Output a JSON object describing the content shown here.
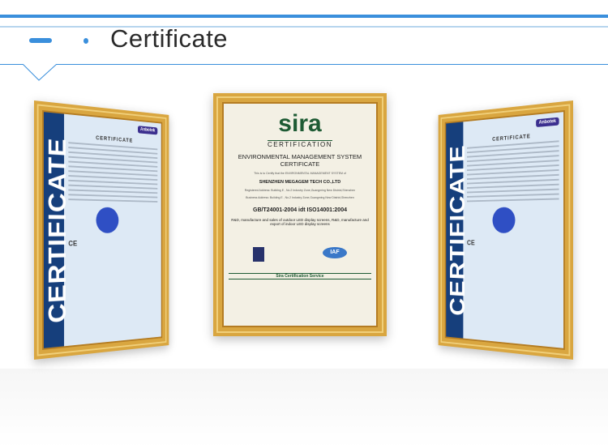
{
  "header": {
    "title": "Certificate"
  },
  "certificates": {
    "left": {
      "side_label": "CERTIFICATE",
      "heading": "CERTIFICATE",
      "badge": "Anbotek",
      "mark": "CE"
    },
    "center": {
      "brand": "sira",
      "brand_sub": "CERTIFICATION",
      "title_line1": "ENVIRONMENTAL MANAGEMENT SYSTEM",
      "title_line2": "CERTIFICATE",
      "intro": "This is to Certify that the ENVIRONMENTAL MANAGEMENT SYSTEM of",
      "company": "SHENZHEN MEGAGEM TECH CO.,LTD",
      "registered_address": "Registered Address: Building E , No.2 Industry Zone,Guangming New District,Shenzhen",
      "business_address": "Business Address: Building E , No.2 Industry Zone,Guangming New District,Shenzhen",
      "standard": "GB/T24001-2004 idt ISO14001:2004",
      "scope": "R&D, manufacture and sales of outdoor LED display screens, R&D, manufacture and export of indoor LED display screens",
      "logo_right": "IAF",
      "service": "Sira Certification Service"
    },
    "right": {
      "side_label": "CERTIFICATE",
      "heading": "CERTIFICATE",
      "badge": "Anbotek",
      "mark": "CE"
    }
  },
  "colors": {
    "accent": "#3a8fdc",
    "frame_gold": "#d9a640",
    "cert_blue": "#163f7c"
  }
}
